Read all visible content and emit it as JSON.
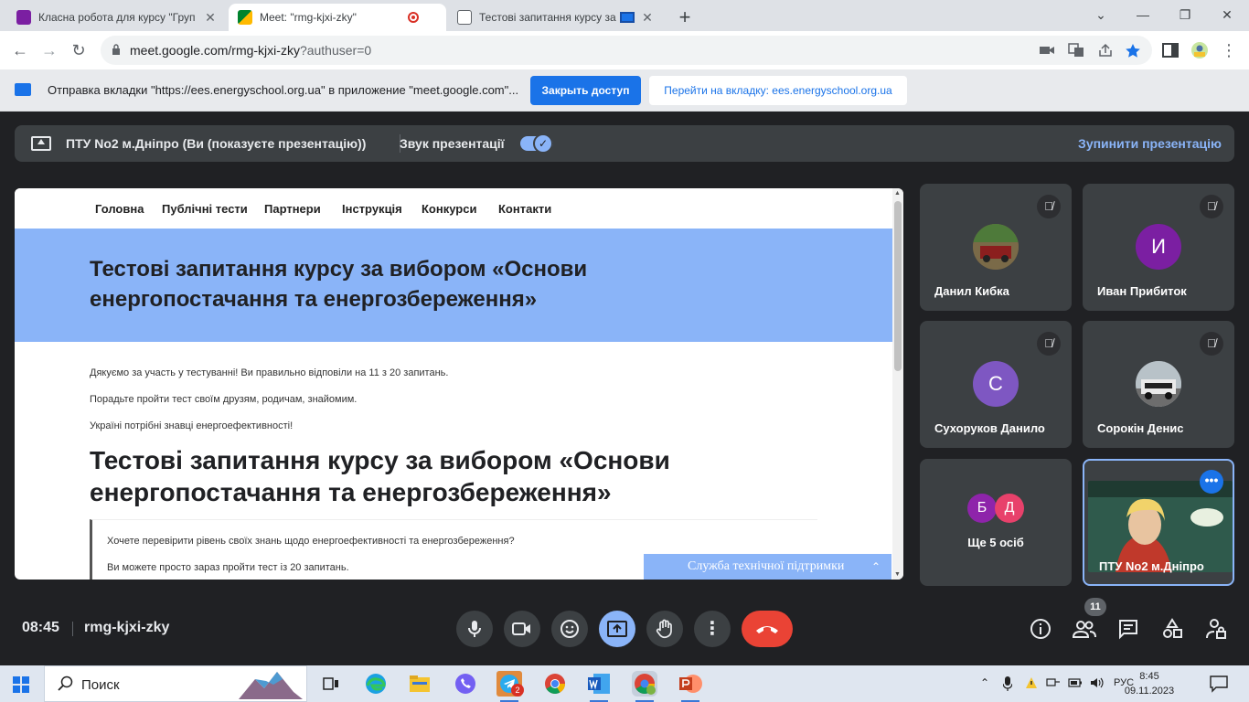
{
  "browser": {
    "tabs": [
      {
        "title": "Класна робота для курсу \"Груп",
        "favicon_color": "#7b1fa2"
      },
      {
        "title": "Meet: \"rmg-kjxi-zky\"",
        "favicon_color": "#00832d"
      },
      {
        "title": "Тестові запитання курсу за",
        "favicon_color": "#1a73e8"
      }
    ],
    "url": "meet.google.com/rmg-kjxi-zky",
    "url_query": "?authuser=0"
  },
  "infobar": {
    "message": "Отправка вкладки \"https://ees.energyschool.org.ua\" в приложение \"meet.google.com\"...",
    "close_access": "Закрыть доступ",
    "goto_tab": "Перейти на вкладку: ees.energyschool.org.ua"
  },
  "presentation_bar": {
    "title": "ПТУ No2 м.Дніпро (Ви (показуєте презентацію))",
    "sound_label": "Звук презентації",
    "sound_on": true,
    "stop_label": "Зупинити презентацію"
  },
  "slide": {
    "nav": [
      "Головна",
      "Публічні тести",
      "Партнери",
      "Інструкція",
      "Конкурси",
      "Контакти"
    ],
    "hero_title": "Тестові запитання курсу за вибором «Основи енергопостачання та енергозбереження»",
    "paragraphs": [
      "Дякуємо за участь у тестуванні! Ви правильно відповіли на 11 з 20 запитань.",
      "Порадьте пройти тест своїм друзям, родичам, знайомим.",
      "Україні потрібні знавці енергоефективності!"
    ],
    "heading2": "Тестові запитання курсу за вибором «Основи енергопостачання та енергозбереження»",
    "quote": [
      "Хочете перевірити рівень своїх знань щодо енергоефективності та енергозбереження?",
      "Ви можете просто зараз пройти тест із 20 запитань."
    ],
    "support_label": "Служба технічної підтримки",
    "accent_color": "#8ab4f8"
  },
  "participants": [
    {
      "name": "Данил Кибка",
      "initial": "",
      "avatar_color": "#6d5a3a",
      "muted": true
    },
    {
      "name": "Иван Прибиток",
      "initial": "И",
      "avatar_color": "#7b1fa2",
      "muted": true
    },
    {
      "name": "Сухоруков Данило",
      "initial": "С",
      "avatar_color": "#7e57c2",
      "muted": true
    },
    {
      "name": "Сорокін Денис",
      "initial": "",
      "avatar_color": "#8a8f95",
      "muted": true
    }
  ],
  "more_tile": {
    "label": "Ще 5 осіб",
    "initials": [
      "Б",
      "Д"
    ],
    "colors": [
      "#8e24aa",
      "#e8416b"
    ]
  },
  "self_tile": {
    "name": "ПТУ No2 м.Дніпро"
  },
  "controls": {
    "time": "08:45",
    "meeting_code": "rmg-kjxi-zky",
    "participant_count": "11"
  },
  "taskbar": {
    "search_placeholder": "Поиск",
    "language": "РУС",
    "time": "8:45",
    "date": "09.11.2023",
    "telegram_badge": "2"
  }
}
